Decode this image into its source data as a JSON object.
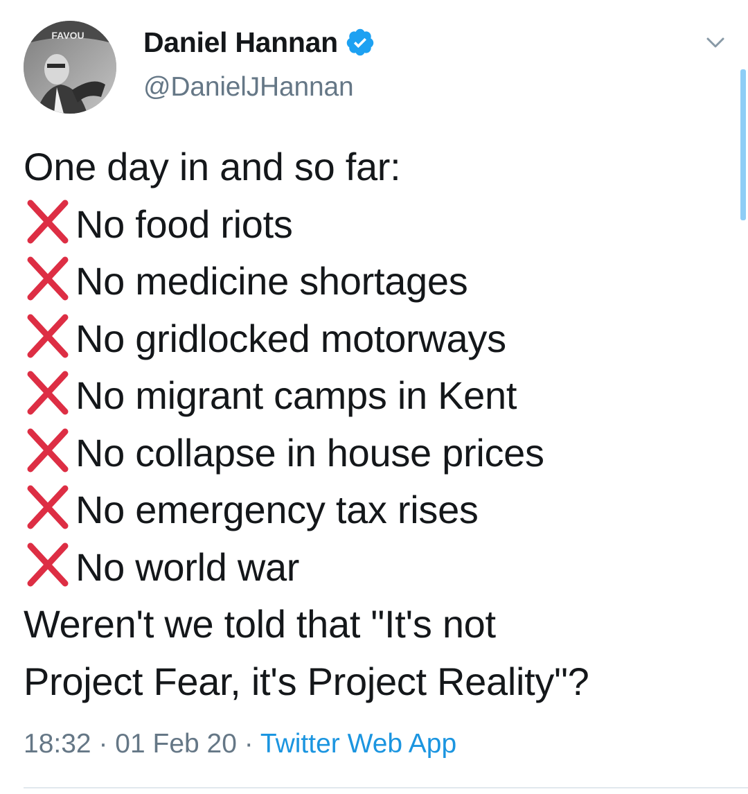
{
  "author": {
    "display_name": "Daniel Hannan",
    "handle": "@DanielJHannan",
    "verified": true,
    "verified_icon": "verified-badge-icon",
    "avatar_banner_text": "FAVOU"
  },
  "tweet": {
    "intro": "One day in and so far:",
    "items": [
      "No food riots",
      "No medicine shortages",
      "No gridlocked motorways",
      "No migrant camps in Kent",
      "No collapse in house prices",
      "No emergency tax rises",
      "No world war"
    ],
    "item_icon": "cross-mark-icon",
    "closing_line_1": "Weren't we told that \"It's not",
    "closing_line_2": "Project Fear, it's Project Reality\"?"
  },
  "meta": {
    "time": "18:32",
    "date": "01 Feb 20",
    "separator": "·",
    "source": "Twitter Web App"
  },
  "colors": {
    "text": "#14171a",
    "secondary": "#657786",
    "link": "#1b95e0",
    "verified": "#1da1f2",
    "cross": "#dd2e44",
    "scrollbar": "#8ecdf6"
  }
}
